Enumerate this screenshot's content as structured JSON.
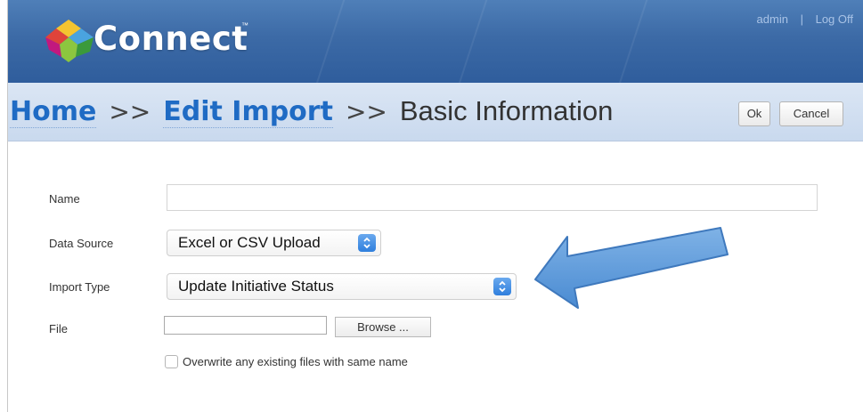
{
  "header": {
    "brand": "Connect",
    "trademark": "™",
    "user": "admin",
    "separator": "|",
    "logout": "Log Off"
  },
  "breadcrumb": {
    "home": "Home",
    "sep1": ">>",
    "edit_import": "Edit Import",
    "sep2": ">>",
    "current": "Basic Information"
  },
  "toolbar": {
    "ok_label": "Ok",
    "cancel_label": "Cancel"
  },
  "form": {
    "name_label": "Name",
    "name_value": "",
    "data_source_label": "Data Source",
    "data_source_value": "Excel or CSV Upload",
    "import_type_label": "Import Type",
    "import_type_value": "Update Initiative Status",
    "file_label": "File",
    "browse_label": "Browse ...",
    "overwrite_label": "Overwrite any existing files with same name",
    "overwrite_checked": false
  },
  "colors": {
    "header_blue": "#3c6aa6",
    "link_blue": "#1f6bc4",
    "crumb_bg": "#d3e1f1",
    "annotation_arrow": "#5b9bd5"
  },
  "icons": {
    "logo": "connect-logo-icon",
    "select_spinner": "updown-chevron-icon",
    "annotation": "arrow-left-icon"
  }
}
